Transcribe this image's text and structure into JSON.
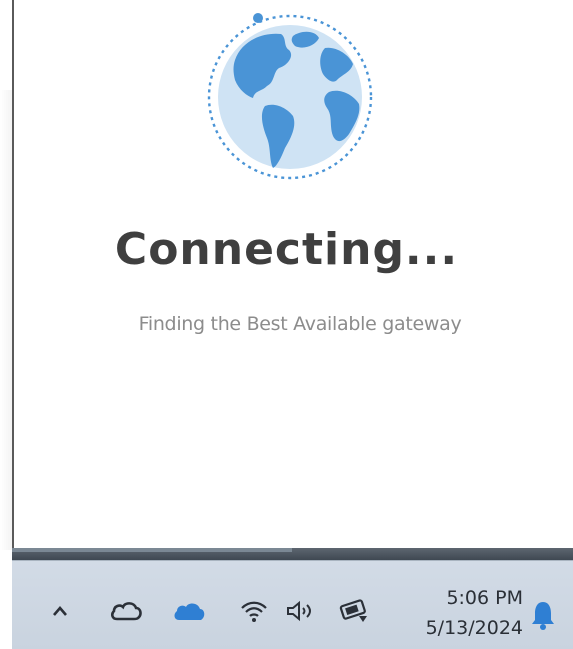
{
  "dialog": {
    "title": "Connecting...",
    "subtitle": "Finding the Best Available gateway",
    "icon": "globe-icon"
  },
  "taskbar": {
    "icons": [
      "chevron-up-icon",
      "cloud-outline-icon",
      "onedrive-cloud-icon",
      "wifi-icon",
      "volume-icon",
      "battery-icon",
      "notification-bell-icon"
    ],
    "time": "5:06 PM",
    "date": "5/13/2024"
  },
  "colors": {
    "globe_ocean": "#cfe3f4",
    "globe_land": "#4a94d6",
    "accent": "#2f7fd3",
    "title": "#3f3f3f",
    "subtitle": "#8c8c8c",
    "taskbar": "#cfd8e3"
  }
}
